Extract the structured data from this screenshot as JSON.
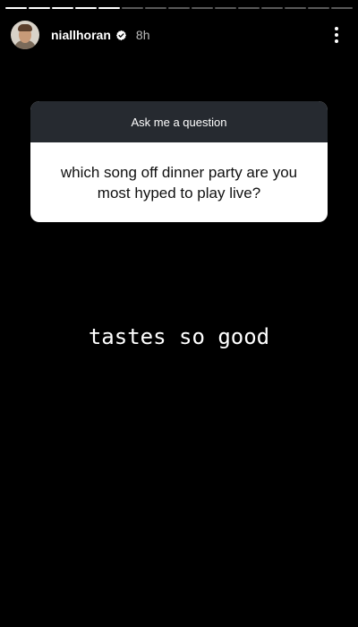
{
  "story": {
    "segments_total": 15,
    "current_segment": 5,
    "username": "niallhoran",
    "time_ago": "8h",
    "question_prompt": "Ask me a question",
    "question_text": "which song off dinner party are you most hyped to play live?",
    "answer_text": "tastes so good"
  },
  "icons": {
    "verified": "verified-badge-icon",
    "more": "more-options-icon"
  },
  "colors": {
    "background": "#000000",
    "card_header": "#262a30",
    "card_body": "#ffffff",
    "verified": "#3797f0"
  }
}
